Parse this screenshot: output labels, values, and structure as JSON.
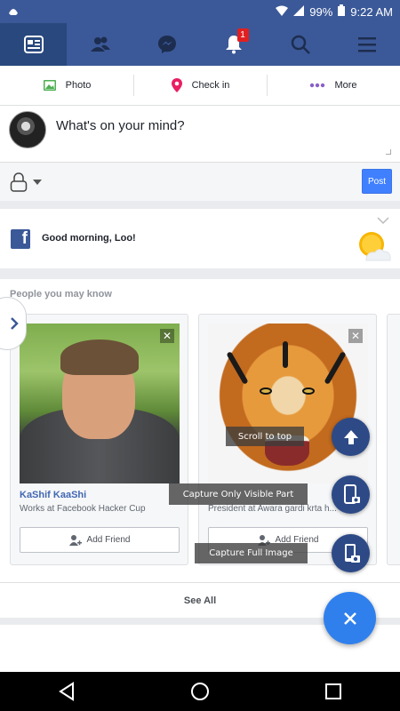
{
  "status_bar": {
    "battery": "99%",
    "time": "9:22 AM"
  },
  "nav": {
    "notifications_badge": "1"
  },
  "composer": {
    "photo_label": "Photo",
    "checkin_label": "Check in",
    "more_label": "More",
    "placeholder": "What's on your mind?",
    "post_label": "Post"
  },
  "greeting": {
    "text": "Good morning, Loo!"
  },
  "pymk": {
    "title": "People you may know",
    "cards": [
      {
        "name": "KaShif KaaShi",
        "work": "Works at Facebook Hacker Cup",
        "add_label": "Add Friend"
      },
      {
        "name": "",
        "work": "President at Awara gardi krta h...",
        "add_label": "Add Friend"
      }
    ],
    "see_all": "See All"
  },
  "overlay": {
    "scroll_top": "Scroll to top",
    "capture_visible": "Capture Only Visible Part",
    "capture_full": "Capture Full Image"
  },
  "colors": {
    "brand": "#3b5998",
    "post_button": "#4080ff",
    "fab": "#2f80ed"
  }
}
